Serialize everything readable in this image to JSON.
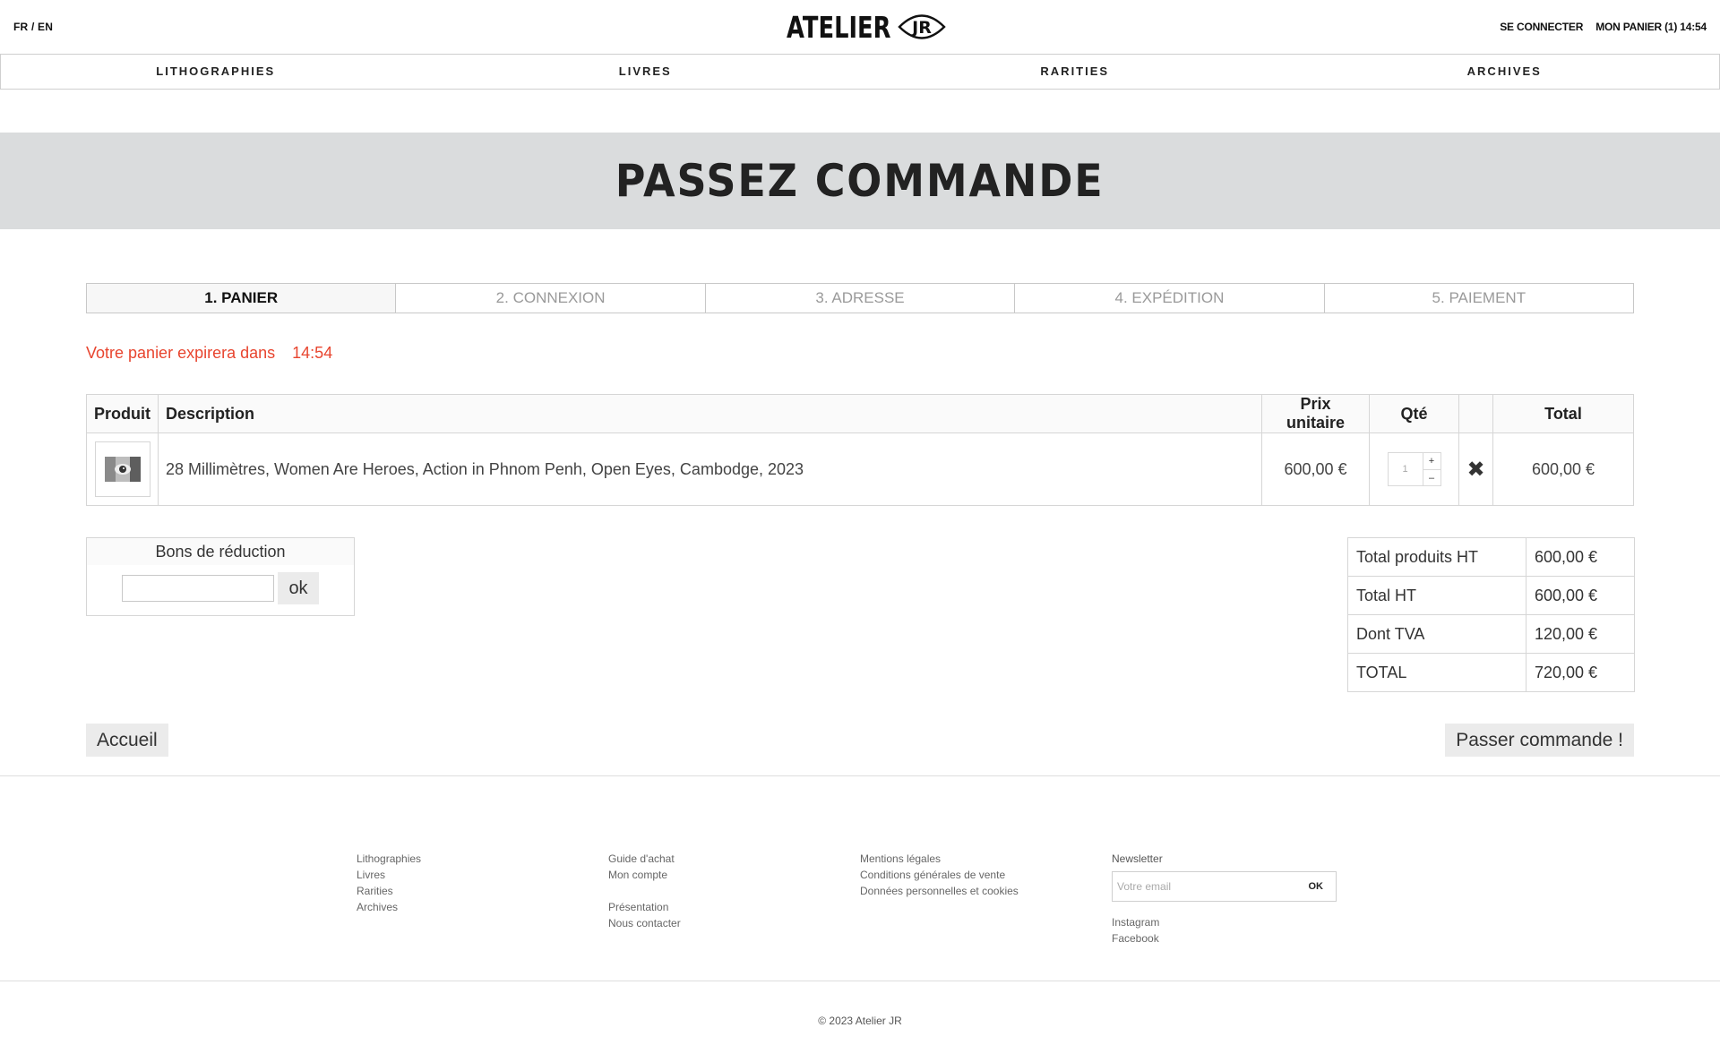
{
  "header": {
    "lang_fr": "FR",
    "lang_sep": "/",
    "lang_en": "EN",
    "logo_text": "ATELIER",
    "logo_badge": "JR",
    "login": "SE CONNECTER",
    "cart": "MON PANIER (1) 14:54"
  },
  "nav": {
    "items": [
      "LITHOGRAPHIES",
      "LIVRES",
      "RARITIES",
      "ARCHIVES"
    ]
  },
  "banner": {
    "title": "PASSEZ COMMANDE"
  },
  "steps": [
    "1. PANIER",
    "2. CONNEXION",
    "3. ADRESSE",
    "4. EXPÉDITION",
    "5. PAIEMENT"
  ],
  "expiry": {
    "label": "Votre panier expirera dans",
    "time": "14:54"
  },
  "cart_table": {
    "headers": {
      "product": "Produit",
      "description": "Description",
      "unit_price": "Prix unitaire",
      "qty": "Qté",
      "total": "Total"
    },
    "rows": [
      {
        "description": "28 Millimètres, Women Are Heroes, Action in Phnom Penh, Open Eyes, Cambodge, 2023",
        "unit_price": "600,00 €",
        "qty": "1",
        "plus": "+",
        "minus": "–",
        "remove": "✖",
        "total": "600,00 €"
      }
    ]
  },
  "voucher": {
    "title": "Bons de réduction",
    "value": "",
    "ok": "ok"
  },
  "totals": [
    {
      "label": "Total produits HT",
      "value": "600,00 €"
    },
    {
      "label": "Total HT",
      "value": "600,00 €"
    },
    {
      "label": "Dont TVA",
      "value": "120,00 €"
    },
    {
      "label": "TOTAL",
      "value": "720,00 €"
    }
  ],
  "buttons": {
    "home": "Accueil",
    "order": "Passer commande !"
  },
  "footer": {
    "col1": [
      "Lithographies",
      "Livres",
      "Rarities",
      "Archives"
    ],
    "col2a": [
      "Guide d'achat",
      "Mon compte"
    ],
    "col2b": [
      "Présentation",
      "Nous contacter"
    ],
    "col3": [
      "Mentions légales",
      "Conditions générales de vente",
      "Données personnelles et cookies"
    ],
    "newsletter_label": "Newsletter",
    "newsletter_placeholder": "Votre email",
    "newsletter_ok": "OK",
    "social": [
      "Instagram",
      "Facebook"
    ],
    "copyright": "© 2023 Atelier JR"
  },
  "colors": {
    "accent_red": "#e8452f",
    "banner_gray": "#dadcdd"
  }
}
